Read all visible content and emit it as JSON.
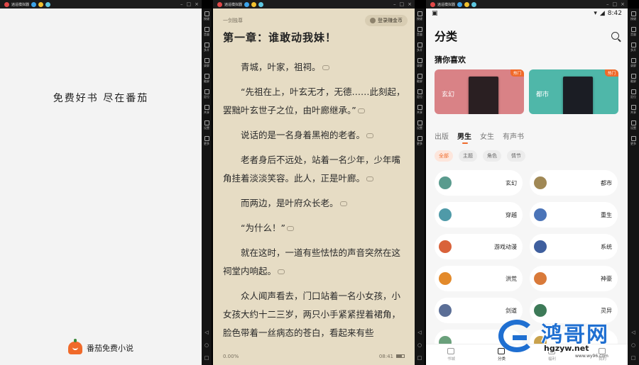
{
  "emulator": {
    "title": "逍遥模拟器",
    "sidebar": [
      "按键",
      "音量",
      "多开",
      "录屏",
      "截屏",
      "定位",
      "共享",
      "设置",
      "更多"
    ],
    "nav": [
      "◁",
      "○",
      "□"
    ]
  },
  "splash": {
    "slogan": "免费好书  尽在番茄",
    "brand": "番茄免费小说"
  },
  "reader": {
    "book_tag": "一剑独尊",
    "login_label": "登录赚金币",
    "chapter_title": "第一章：谁敢动我妹！",
    "paragraphs": [
      "青城，叶家，祖祠。",
      "“先祖在上，叶玄无才，无德……此刻起，罢黜叶玄世子之位，由叶廊继承。”",
      "说话的是一名身着黑袍的老者。",
      "老者身后不远处，站着一名少年，少年嘴角挂着淡淡笑容。此人，正是叶廊。",
      "而两边，是叶府众长老。",
      "“为什么！”",
      "就在这时，一道有些怯怯的声音突然在这祠堂内响起。",
      "众人闻声看去，门口站着一名小女孩，小女孩大约十二三岁，两只小手紧紧捏着裙角，脸色带着一丝病态的苍白，看起来有些"
    ],
    "progress": "0.00%",
    "time": "08:41"
  },
  "category_page": {
    "status_time": "8:42",
    "title": "分类",
    "guess_title": "猜你喜欢",
    "recommendations": [
      {
        "label": "玄幻",
        "badge": "热门",
        "bg": "#d98286",
        "cover": "#2a1f22"
      },
      {
        "label": "都市",
        "badge": "热门",
        "bg": "#4fb7a9",
        "cover": "#1b1d24"
      }
    ],
    "tabs": [
      "出版",
      "男生",
      "女生",
      "有声书"
    ],
    "active_tab": 1,
    "chips": [
      "全部",
      "主题",
      "角色",
      "情节"
    ],
    "categories": [
      {
        "label": "玄幻",
        "color": "#5a9b8e"
      },
      {
        "label": "都市",
        "color": "#a08855"
      },
      {
        "label": "穿越",
        "color": "#4f9aa8"
      },
      {
        "label": "重生",
        "color": "#4b74b8"
      },
      {
        "label": "游戏动漫",
        "color": "#d9623a"
      },
      {
        "label": "系统",
        "color": "#3f5f9e"
      },
      {
        "label": "洪荒",
        "color": "#e38a2b"
      },
      {
        "label": "神豪",
        "color": "#d97a3a"
      },
      {
        "label": "剑道",
        "color": "#5b6e96"
      },
      {
        "label": "灵异",
        "color": "#3d7a58"
      },
      {
        "label": "",
        "color": "#6aa07b"
      },
      {
        "label": "",
        "color": "#c9a24d"
      }
    ],
    "bottom_nav": [
      "书城",
      "分类",
      "福利",
      "我的"
    ]
  },
  "watermark": {
    "title": "鸿哥网",
    "sub": "hgzyw.net",
    "url": "www.wy96.com"
  }
}
